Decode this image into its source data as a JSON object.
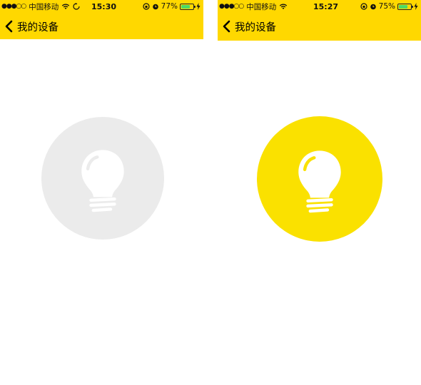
{
  "screens": [
    {
      "status": {
        "signal": "●●●○○",
        "carrier": "中国移动",
        "wifi_icon": "wifi-icon",
        "sync_icon": "sync-icon",
        "time": "15:30",
        "battery_percent": "77%",
        "battery_level": 0.77
      },
      "nav": {
        "back_icon": "chevron-left-icon",
        "title": "我的设备"
      },
      "bulb": {
        "state": "off",
        "circle_color": "#EBEBEB",
        "icon": "lightbulb-icon"
      }
    },
    {
      "status": {
        "signal": "●●●○○",
        "carrier": "中国移动",
        "wifi_icon": "wifi-icon",
        "time": "15:27",
        "battery_percent": "75%",
        "battery_level": 0.75
      },
      "nav": {
        "back_icon": "chevron-left-icon",
        "title": "我的设备"
      },
      "bulb": {
        "state": "on",
        "circle_color": "#FAE100",
        "icon": "lightbulb-icon"
      }
    }
  ],
  "colors": {
    "header": "#FFD800",
    "battery_fill": "#4CD964",
    "bulb_glyph": "#FFFFFF"
  }
}
